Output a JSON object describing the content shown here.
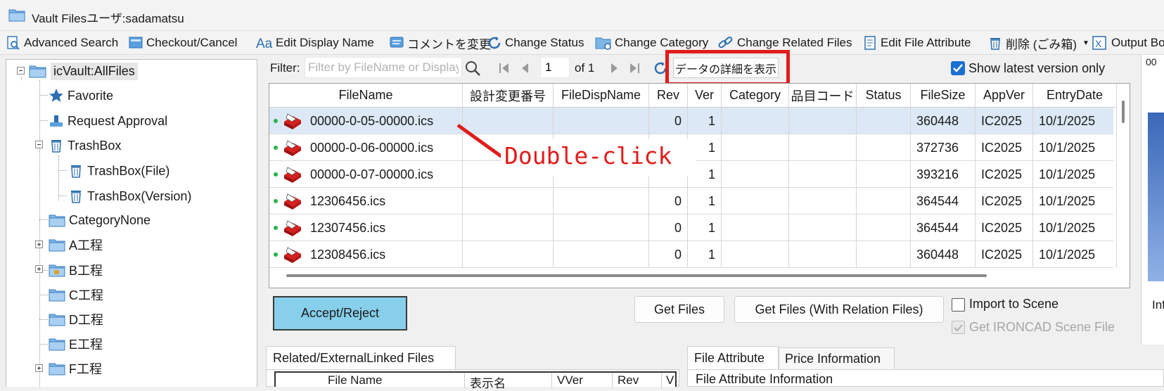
{
  "window": {
    "title": "Vault Filesユーザ:sadamatsu"
  },
  "toolbar": {
    "items": [
      {
        "label": "Advanced Search",
        "icon": "advanced-search-icon"
      },
      {
        "label": "Checkout/Cancel",
        "icon": "checkout-icon"
      },
      {
        "label": "Edit Display Name",
        "icon": "text-aa-icon"
      },
      {
        "label": "コメントを変更",
        "icon": "comment-icon"
      },
      {
        "label": "Change Status",
        "icon": "refresh-status-icon"
      },
      {
        "label": "Change Category",
        "icon": "folder-category-icon"
      },
      {
        "label": "Change Related Files",
        "icon": "link-icon"
      },
      {
        "label": "Edit File Attribute",
        "icon": "document-icon"
      },
      {
        "label": "削除 (ごみ箱)",
        "icon": "trash-icon"
      },
      {
        "label": "Output Bo",
        "icon": "excel-icon"
      }
    ]
  },
  "tree": {
    "root": "icVault:AllFiles",
    "items": [
      {
        "label": "Favorite",
        "icon": "star-icon"
      },
      {
        "label": "Request Approval",
        "icon": "approval-icon"
      },
      {
        "label": "TrashBox",
        "icon": "trash-icon"
      },
      {
        "label": "TrashBox(File)",
        "icon": "trash-icon"
      },
      {
        "label": "TrashBox(Version)",
        "icon": "trash-icon"
      },
      {
        "label": "CategoryNone",
        "icon": "folder-icon"
      },
      {
        "label": "A工程",
        "icon": "folder-icon"
      },
      {
        "label": "B工程",
        "icon": "locked-folder-icon"
      },
      {
        "label": "C工程",
        "icon": "folder-icon"
      },
      {
        "label": "D工程",
        "icon": "folder-icon"
      },
      {
        "label": "E工程",
        "icon": "folder-icon"
      },
      {
        "label": "F工程",
        "icon": "folder-icon"
      }
    ]
  },
  "filter": {
    "label": "Filter:",
    "placeholder": "Filter by FileName or Display",
    "page": "1",
    "of_label": "of 1",
    "detail_button": "データの詳細を表示",
    "show_latest_label": "Show latest version only",
    "show_latest_checked": true
  },
  "grid": {
    "columns": [
      "FileName",
      "設計変更番号",
      "FileDispName",
      "Rev",
      "Ver",
      "Category",
      "品目コード",
      "Status",
      "FileSize",
      "AppVer",
      "EntryDate"
    ],
    "rows": [
      {
        "filename": "00000-0-05-00000.ics",
        "change_no": "",
        "disp": "",
        "rev": "0",
        "ver": "1",
        "category": "",
        "item_code": "",
        "status": "",
        "size": "360448",
        "appver": "IC2025",
        "date": "10/1/2025"
      },
      {
        "filename": "00000-0-06-00000.ics",
        "change_no": "",
        "disp": "",
        "rev": "",
        "ver": "1",
        "category": "",
        "item_code": "",
        "status": "",
        "size": "372736",
        "appver": "IC2025",
        "date": "10/1/2025"
      },
      {
        "filename": "00000-0-07-00000.ics",
        "change_no": "",
        "disp": "",
        "rev": "",
        "ver": "1",
        "category": "",
        "item_code": "",
        "status": "",
        "size": "393216",
        "appver": "IC2025",
        "date": "10/1/2025"
      },
      {
        "filename": "12306456.ics",
        "change_no": "",
        "disp": "",
        "rev": "0",
        "ver": "1",
        "category": "",
        "item_code": "",
        "status": "",
        "size": "364544",
        "appver": "IC2025",
        "date": "10/1/2025"
      },
      {
        "filename": "12307456.ics",
        "change_no": "",
        "disp": "",
        "rev": "0",
        "ver": "1",
        "category": "",
        "item_code": "",
        "status": "",
        "size": "364544",
        "appver": "IC2025",
        "date": "10/1/2025"
      },
      {
        "filename": "12308456.ics",
        "change_no": "",
        "disp": "",
        "rev": "0",
        "ver": "1",
        "category": "",
        "item_code": "",
        "status": "",
        "size": "360448",
        "appver": "IC2025",
        "date": "10/1/2025"
      }
    ]
  },
  "annotation": {
    "text": "Double-click",
    "color": "#e21b1b"
  },
  "actions": {
    "accept_reject": "Accept/Reject",
    "get_files": "Get Files",
    "get_files_relation": "Get Files (With Relation Files)",
    "import_to_scene": "Import to Scene",
    "get_scene_file": "Get IRONCAD Scene File"
  },
  "bottom_left": {
    "tab": "Related/ExternalLinked Files",
    "columns": [
      "File Name",
      "表示名",
      "VVer",
      "Rev",
      "V"
    ]
  },
  "bottom_right": {
    "tabs": [
      "File Attribute",
      "Price Information"
    ],
    "section_title": "File Attribute Information"
  },
  "right_pane": {
    "top_text": "00",
    "label": "Inf"
  },
  "colors": {
    "accent": "#1a6fd1",
    "selected_row": "#dce8f5",
    "accept_button": "#87cfea",
    "highlight_red": "#e21b1b"
  }
}
